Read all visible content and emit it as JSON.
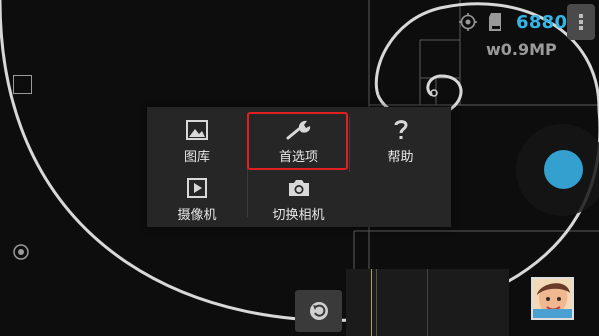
{
  "status": {
    "shots_remaining": "6880",
    "resolution": "w0.9MP",
    "target_icon": "crosshair-icon",
    "storage_icon": "sd-card-icon"
  },
  "menu": {
    "items": [
      {
        "label": "图库",
        "icon": "gallery-icon"
      },
      {
        "label": "首选项",
        "icon": "wrench-icon"
      },
      {
        "label": "帮助",
        "icon": "question-icon"
      },
      {
        "label": "摄像机",
        "icon": "video-icon"
      },
      {
        "label": "切换相机",
        "icon": "camera-icon"
      }
    ]
  },
  "colors": {
    "accent": "#33b5e5",
    "highlight": "#e02020",
    "shutter": "#33a0cf"
  }
}
